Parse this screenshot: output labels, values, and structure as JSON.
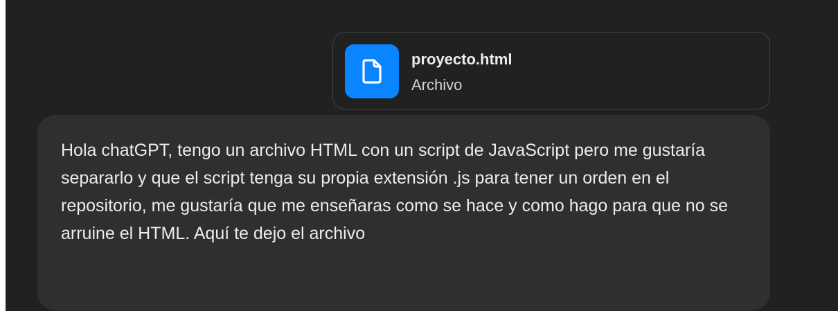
{
  "attachment": {
    "file_name": "proyecto.html",
    "file_type": "Archivo",
    "icon": "document-icon",
    "icon_color": "#0a84ff"
  },
  "message": {
    "text": "Hola chatGPT, tengo un archivo HTML con un script de JavaScript pero me gustaría separarlo y que el script tenga su propia extensión .js para tener un orden en el repositorio, me gustaría que me enseñaras como se hace y como hago para que no se arruine el HTML. Aquí te dejo el archivo"
  },
  "colors": {
    "background": "#212121",
    "bubble": "#2f2f2f",
    "text": "#ececec",
    "border": "#424242"
  }
}
